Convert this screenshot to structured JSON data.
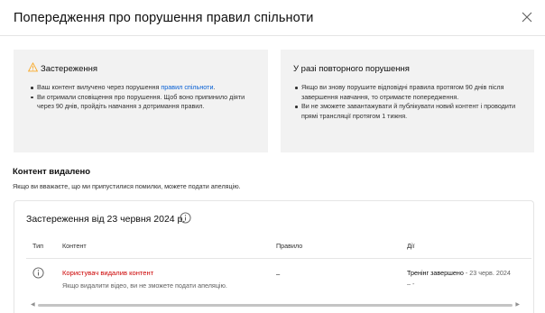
{
  "dialog": {
    "title": "Попередження про порушення правил спільноти"
  },
  "warning_panel": {
    "heading": "Застереження",
    "item1_before_link": "Ваш контент вилучено через порушення ",
    "item1_link": "правил спільноти",
    "item1_after_link": ".",
    "item2": "Ви отримали сповіщення про порушення. Щоб воно припинило діяти через 90 днів, пройдіть навчання з дотримання правил."
  },
  "repeat_panel": {
    "heading": "У разі повторного порушення",
    "item1": "Якщо ви знову порушите відповідні правила протягом 90 днів після завершення навчання, то отримаєте попередження.",
    "item2": "Ви не зможете завантажувати й публікувати новий контент і проводити прямі трансляції протягом 1 тижня."
  },
  "section": {
    "title": "Контент видалено",
    "subtitle": "Якщо ви вважаєте, що ми припустилися помилки, можете подати апеляцію."
  },
  "card": {
    "title": "Застереження від 23 червня 2024 р.",
    "columns": {
      "type": "Тип",
      "content": "Контент",
      "rule": "Правило",
      "actions": "Дії"
    },
    "row": {
      "content_title": "Користувач видалив контент",
      "content_desc": "Якщо видалити відео, ви не зможете подати апеляцію.",
      "rule": "–",
      "action": "Тренінг завершено",
      "action_date": " - 23 черв. 2024",
      "action_sub": "– -"
    }
  },
  "colors": {
    "link": "#065fd4",
    "removed": "#cc0000",
    "panel_bg": "#f2f2f2",
    "warning_icon": "#f9a825"
  }
}
